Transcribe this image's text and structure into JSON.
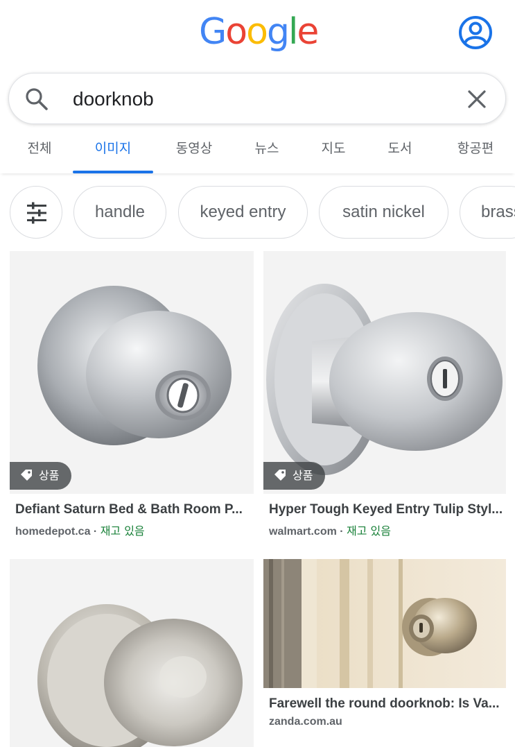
{
  "header": {
    "logo_letters": [
      "G",
      "o",
      "o",
      "g",
      "l",
      "e"
    ],
    "logo_colors": [
      "#4285F4",
      "#EA4335",
      "#FBBC05",
      "#4285F4",
      "#34A853",
      "#EA4335"
    ],
    "account_icon": "account-circle-icon"
  },
  "search": {
    "query": "doorknob",
    "search_icon": "search-icon",
    "clear_icon": "close-icon"
  },
  "tabs": [
    {
      "label": "전체",
      "active": false
    },
    {
      "label": "이미지",
      "active": true
    },
    {
      "label": "동영상",
      "active": false
    },
    {
      "label": "뉴스",
      "active": false
    },
    {
      "label": "지도",
      "active": false
    },
    {
      "label": "도서",
      "active": false
    },
    {
      "label": "항공편",
      "active": false
    }
  ],
  "chips": {
    "filter_icon": "tune-icon",
    "items": [
      "handle",
      "keyed entry",
      "satin nickel",
      "brass"
    ]
  },
  "results": [
    {
      "title": "Defiant Saturn Bed & Bath Room P...",
      "source": "homedepot.ca",
      "separator": " · ",
      "stock": "재고 있음",
      "badge": "상품"
    },
    {
      "title": "Hyper Tough Keyed Entry Tulip Styl...",
      "source": "walmart.com",
      "separator": " · ",
      "stock": "재고 있음",
      "badge": "상품"
    },
    {
      "title": "",
      "source": "",
      "separator": "",
      "stock": "",
      "badge": ""
    },
    {
      "title": "Farewell the round doorknob: Is Va...",
      "source": "zanda.com.au",
      "separator": "",
      "stock": "",
      "badge": ""
    }
  ],
  "colors": {
    "accent": "#1a73e8",
    "stock_green": "#188038",
    "tab_text": "#5f6368"
  }
}
